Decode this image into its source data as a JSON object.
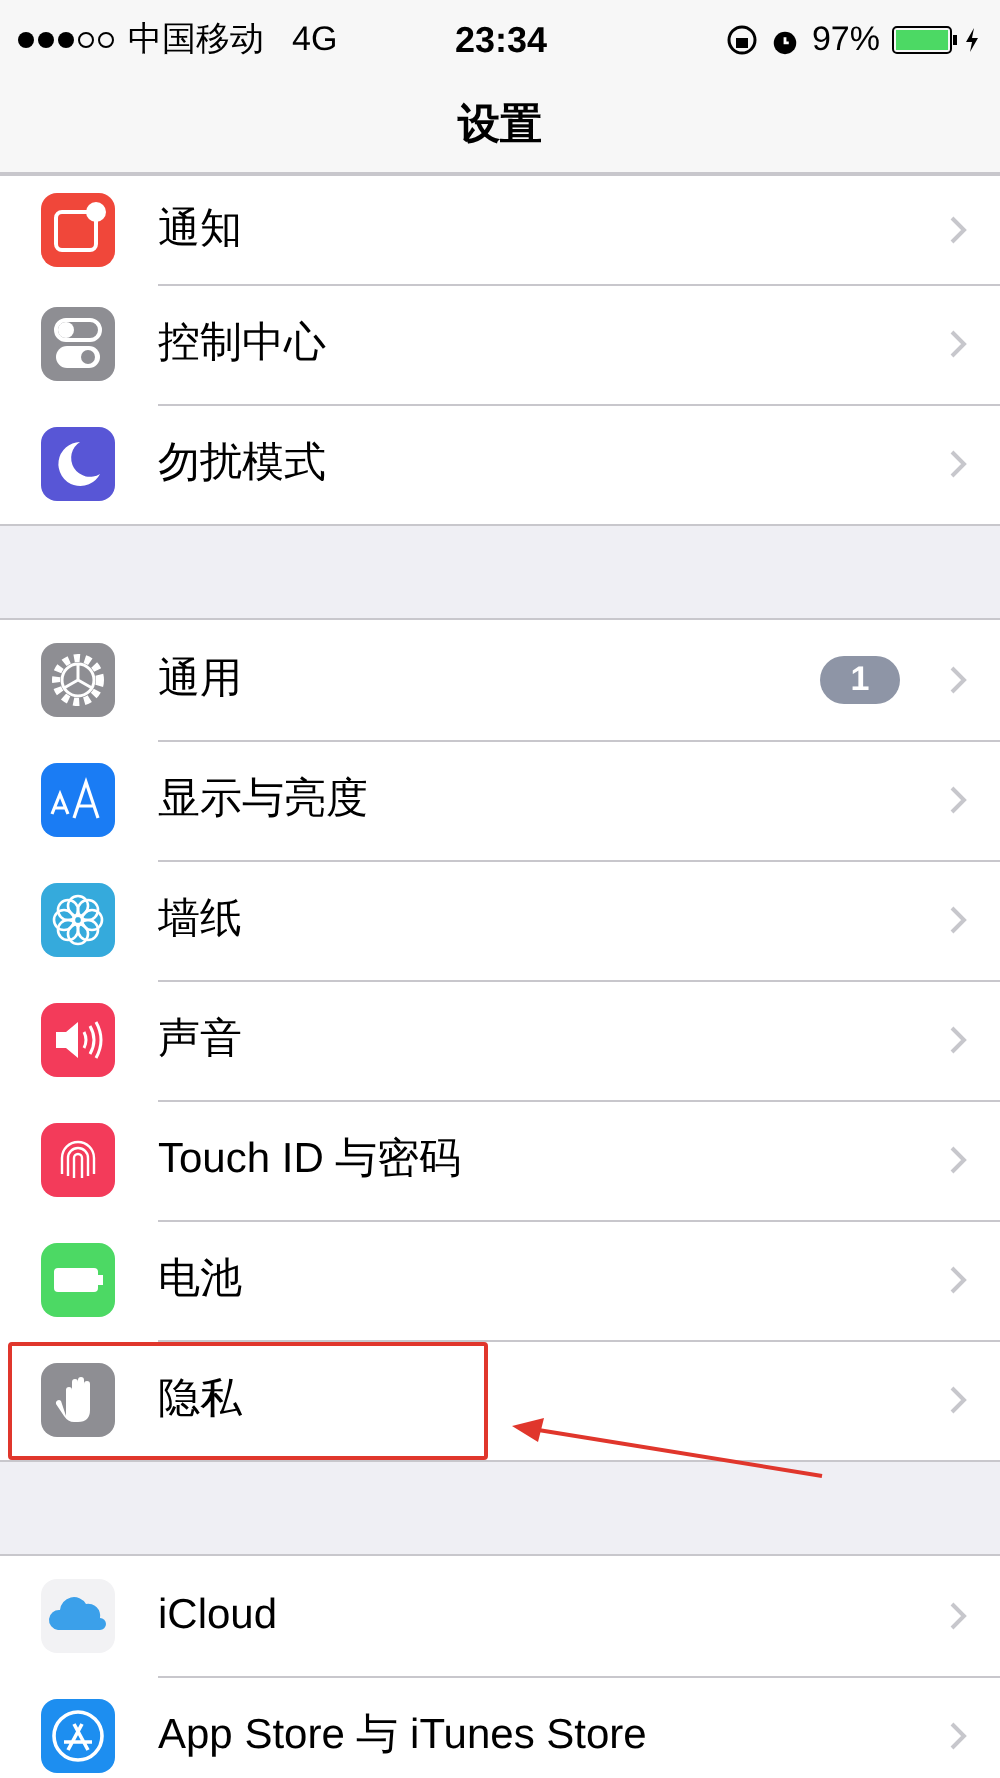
{
  "status_bar": {
    "carrier": "中国移动",
    "network": "4G",
    "time": "23:34",
    "battery_text": "97%"
  },
  "nav": {
    "title": "设置"
  },
  "groups": [
    {
      "items": [
        {
          "label": "通知",
          "kind": "notifications",
          "color": "#f0473a",
          "highlighted": false
        },
        {
          "label": "控制中心",
          "kind": "control",
          "color": "#8e8e93",
          "highlighted": false
        },
        {
          "label": "勿扰模式",
          "kind": "moon",
          "color": "#5856d6",
          "highlighted": false
        }
      ]
    },
    {
      "items": [
        {
          "label": "通用",
          "kind": "gear",
          "color": "#8e8e93",
          "badge": "1",
          "highlighted": false
        },
        {
          "label": "显示与亮度",
          "kind": "text",
          "color": "#1a7cf4",
          "highlighted": false
        },
        {
          "label": "墙纸",
          "kind": "flower",
          "color": "#35aadc",
          "highlighted": false
        },
        {
          "label": "声音",
          "kind": "speaker",
          "color": "#f33b5a",
          "highlighted": false
        },
        {
          "label": "Touch ID 与密码",
          "kind": "fingerprint",
          "color": "#f33b5a",
          "highlighted": false
        },
        {
          "label": "电池",
          "kind": "battery",
          "color": "#4cd964",
          "highlighted": false
        },
        {
          "label": "隐私",
          "kind": "hand",
          "color": "#8e8e93",
          "highlighted": true
        }
      ]
    },
    {
      "items": [
        {
          "label": "iCloud",
          "kind": "cloud",
          "color": "#f2f2f4",
          "highlighted": false
        },
        {
          "label": "App Store 与 iTunes Store",
          "kind": "appstore",
          "color": "#1d8ef0",
          "highlighted": false
        }
      ]
    }
  ]
}
